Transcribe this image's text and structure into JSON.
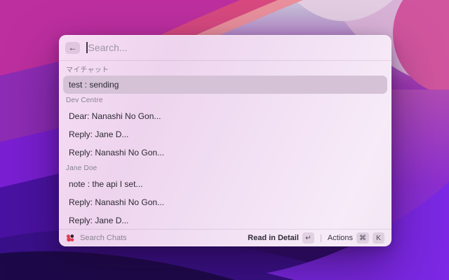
{
  "window": {
    "search": {
      "placeholder": "Search...",
      "back_icon": "←"
    },
    "sections": [
      {
        "label": "マイチャット",
        "items": [
          {
            "text": "test : sending",
            "selected": true
          }
        ]
      },
      {
        "label": "Dev Centre",
        "items": [
          {
            "text": "Dear: Nanashi No Gon..."
          },
          {
            "text": "Reply: Jane D..."
          },
          {
            "text": "Reply: Nanashi No Gon..."
          }
        ]
      },
      {
        "label": "Jane Doe",
        "items": [
          {
            "text": "note : the api I set..."
          },
          {
            "text": "Reply: Nanashi No Gon..."
          },
          {
            "text": "Reply: Jane D..."
          }
        ]
      }
    ],
    "footer": {
      "app_name": "Search Chats",
      "primary_action": "Read in Detail",
      "primary_key": "↵",
      "secondary_action": "Actions",
      "secondary_key_1": "⌘",
      "secondary_key_2": "K"
    }
  },
  "colors": {
    "accent_red": "#e23b50",
    "selected_row": "#d5c2d6",
    "panel_pink": "#f1dff3",
    "wallpaper_magenta": "#bd2f9f",
    "wallpaper_purple": "#7a1fd2",
    "wallpaper_indigo": "#2a0d62"
  }
}
